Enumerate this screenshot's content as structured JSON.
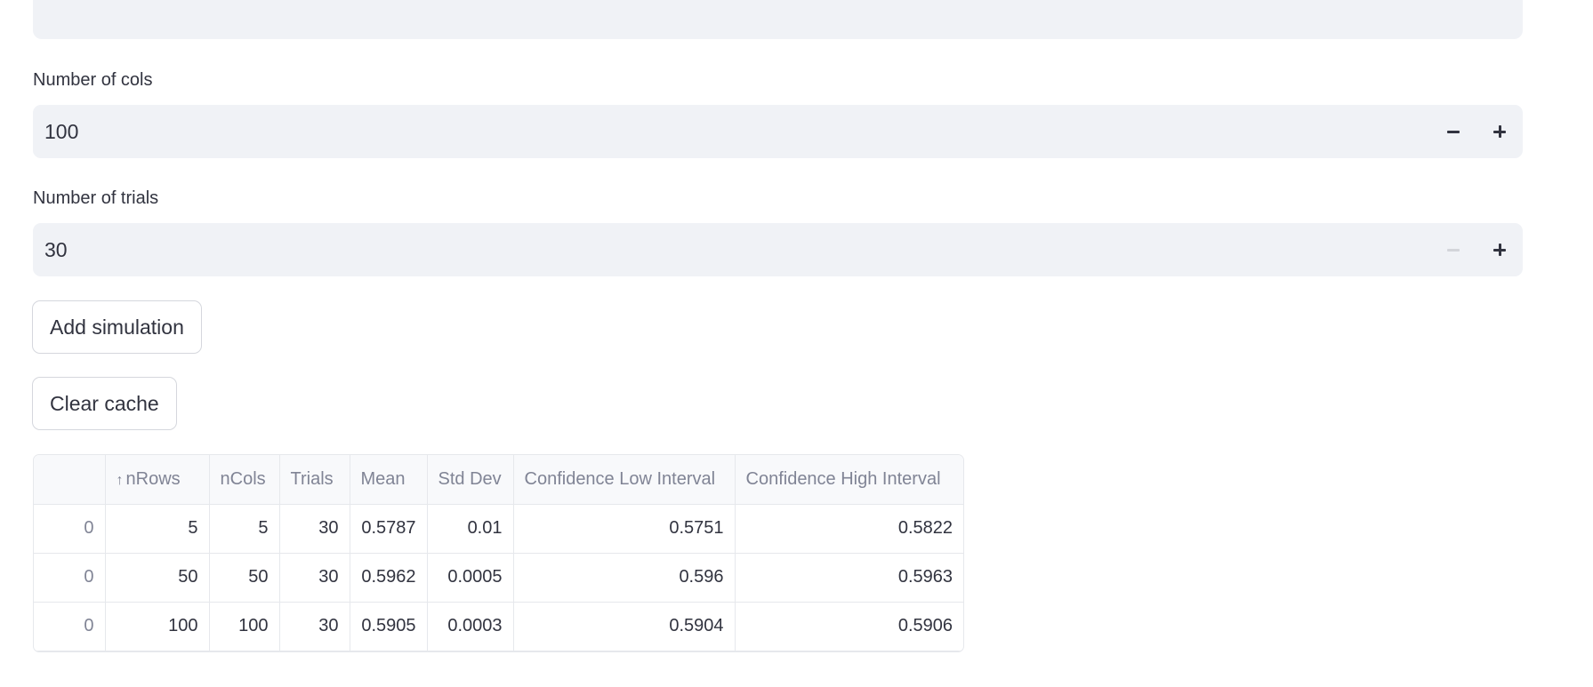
{
  "fields": [
    {
      "label": "Number of cols",
      "value": "100",
      "minus_disabled": false
    },
    {
      "label": "Number of trials",
      "value": "30",
      "minus_disabled": true
    }
  ],
  "buttons": {
    "add_simulation": "Add simulation",
    "clear_cache": "Clear cache"
  },
  "table": {
    "columns": [
      "",
      "nRows",
      "nCols",
      "Trials",
      "Mean",
      "Std Dev",
      "Confidence Low Interval",
      "Confidence High Interval"
    ],
    "sorted_column": "nRows",
    "sort_direction": "ascending",
    "rows": [
      [
        "0",
        "5",
        "5",
        "30",
        "0.5787",
        "0.01",
        "0.5751",
        "0.5822"
      ],
      [
        "0",
        "50",
        "50",
        "30",
        "0.5962",
        "0.0005",
        "0.596",
        "0.5963"
      ],
      [
        "0",
        "100",
        "100",
        "30",
        "0.5905",
        "0.0003",
        "0.5904",
        "0.5906"
      ]
    ]
  }
}
